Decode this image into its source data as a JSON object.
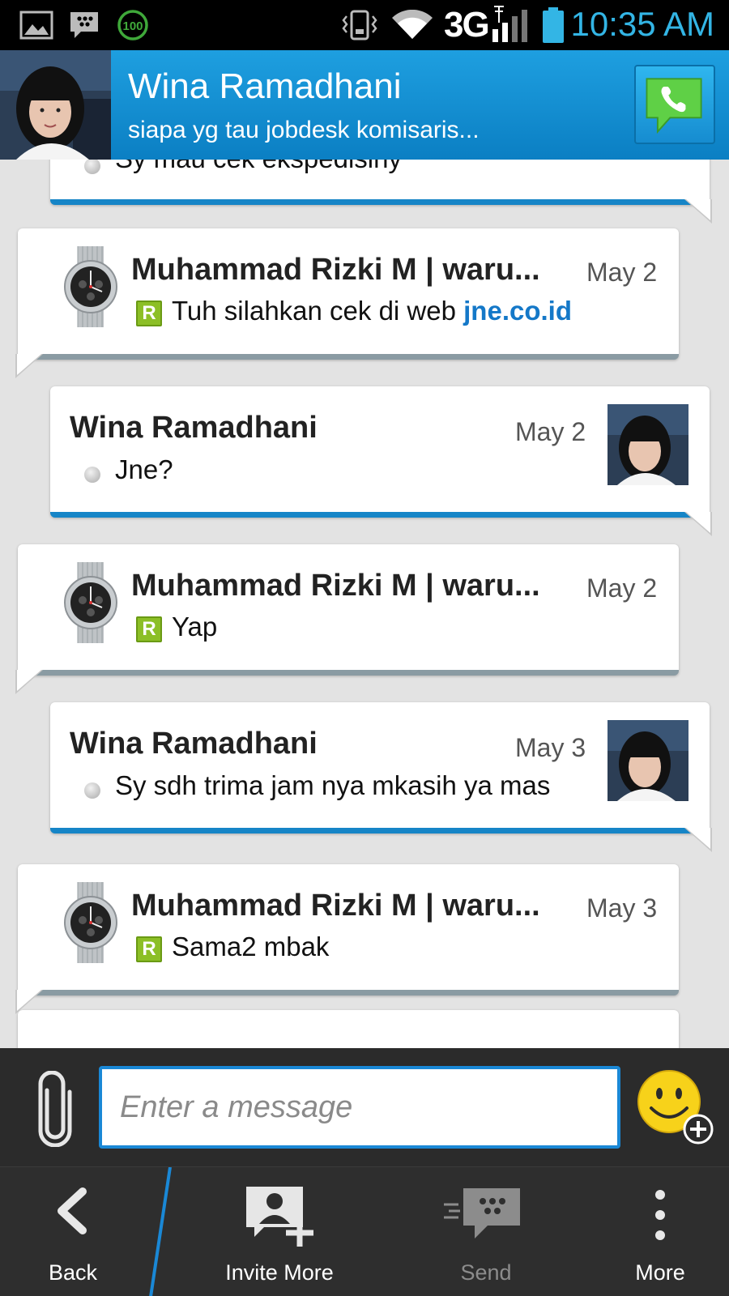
{
  "status_bar": {
    "network": "3G",
    "time": "10:35 AM",
    "icons": [
      "gallery-icon",
      "bbm-icon",
      "battery-saver-icon",
      "vibrate-icon",
      "wifi-icon",
      "signal-icon",
      "battery-icon"
    ],
    "badge_text": "100"
  },
  "header": {
    "contact_name": "Wina Ramadhani",
    "contact_status": "siapa yg tau jobdesk komisaris..."
  },
  "messages": [
    {
      "sender": "",
      "date": "",
      "text": "Sy mau cek ekspedisiny",
      "mine": true
    },
    {
      "sender": "Muhammad Rizki M | waru...",
      "date": "May 2",
      "text_prefix": "Tuh silahkan cek di web ",
      "link": "jne.co.id",
      "badge": "R",
      "mine": false
    },
    {
      "sender": "Wina Ramadhani",
      "date": "May 2",
      "text": "Jne?",
      "mine": true
    },
    {
      "sender": "Muhammad Rizki M | waru...",
      "date": "May 2",
      "text": "Yap",
      "badge": "R",
      "mine": false
    },
    {
      "sender": "Wina Ramadhani",
      "date": "May 3",
      "text": "Sy sdh trima jam nya mkasih ya mas",
      "mine": true
    },
    {
      "sender": "Muhammad Rizki M | waru...",
      "date": "May 3",
      "text": "Sama2 mbak",
      "badge": "R",
      "mine": false
    }
  ],
  "compose": {
    "placeholder": "Enter a message"
  },
  "actions": {
    "back": "Back",
    "invite": "Invite More",
    "send": "Send",
    "more": "More"
  },
  "colors": {
    "accent": "#1685c7",
    "header": "#1e9fe0",
    "link": "#1478c8",
    "r_badge": "#8cbf26",
    "call_icon": "#5fd046"
  }
}
